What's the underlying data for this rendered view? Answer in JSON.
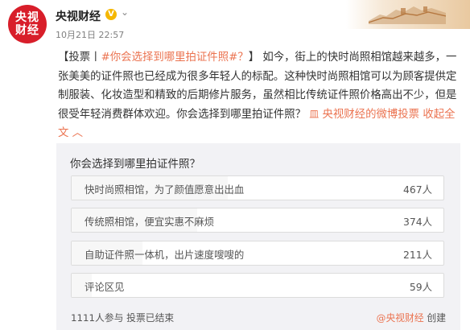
{
  "account": {
    "avatar_text_line1": "央视",
    "avatar_text_line2": "财经",
    "name": "央视财经",
    "verified_mark": "V",
    "timestamp": "10月21日 22:57"
  },
  "post": {
    "tag_prefix": "【投票丨",
    "topic_link": "#你会选择到哪里拍证件照#？",
    "tag_suffix": "】",
    "text": "如今，街上的快时尚照相馆越来越多，一张美美的证件照也已经成为很多年轻人的标配。这种快时尚照相馆可以为顾客提供定制服装、化妆造型和精致的后期修片服务，虽然相比传统证件照价格高出不少，但是很受年轻消费群体欢迎。你会选择到哪里拍证件照？",
    "source_icon": "皿",
    "source_name": "央视财经的微博投票",
    "collapse_label": "收起全文",
    "collapse_icon": "︿"
  },
  "poll": {
    "question": "你会选择到哪里拍证件照？",
    "options": [
      {
        "label": "快时尚照相馆，为了颜值愿意出出血",
        "count": "467人",
        "votes": 467
      },
      {
        "label": "传统照相馆，便宜实惠不麻烦",
        "count": "374人",
        "votes": 374
      },
      {
        "label": "自助证件照一体机，出片速度嗖嗖的",
        "count": "211人",
        "votes": 211
      },
      {
        "label": "评论区见",
        "count": "59人",
        "votes": 59
      }
    ],
    "participants": "1111人参与",
    "status": "投票已结束",
    "creator": "@央视财经",
    "created_label": "创建"
  }
}
